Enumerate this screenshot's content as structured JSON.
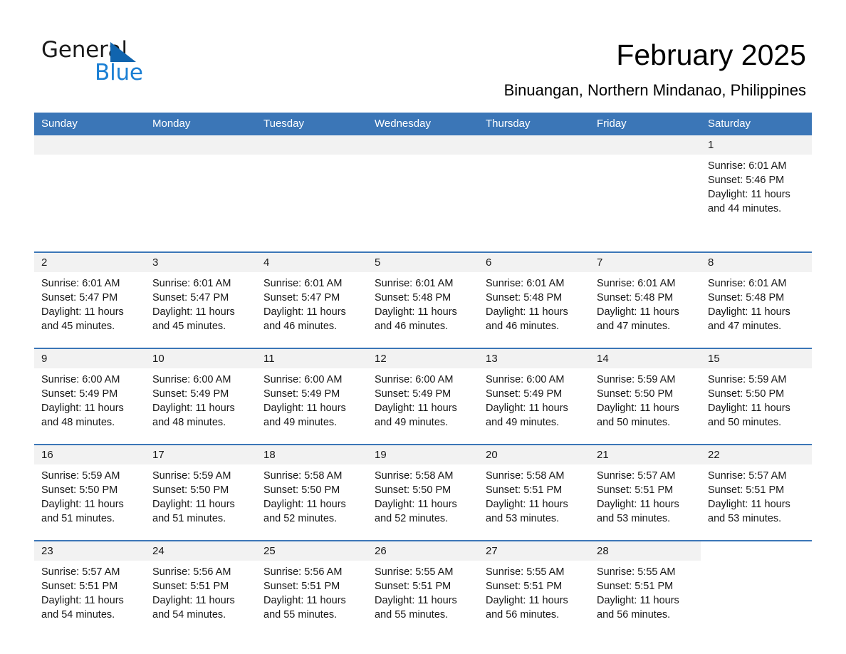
{
  "brand": {
    "name_part1": "General",
    "name_part2": "Blue",
    "triangle_color": "#1064ae",
    "blue_color": "#1a7fd4"
  },
  "header": {
    "title": "February 2025",
    "subtitle": "Binuangan, Northern Mindanao, Philippines"
  },
  "theme": {
    "header_blue": "#3b76b7",
    "daynum_band": "#f2f2f2",
    "text": "#161616"
  },
  "weekday_headers": [
    "Sunday",
    "Monday",
    "Tuesday",
    "Wednesday",
    "Thursday",
    "Friday",
    "Saturday"
  ],
  "labels": {
    "sunrise_prefix": "Sunrise: ",
    "sunset_prefix": "Sunset: ",
    "daylight_prefix": "Daylight: "
  },
  "weeks": [
    [
      {
        "day": "",
        "empty": true
      },
      {
        "day": "",
        "empty": true
      },
      {
        "day": "",
        "empty": true
      },
      {
        "day": "",
        "empty": true
      },
      {
        "day": "",
        "empty": true
      },
      {
        "day": "",
        "empty": true
      },
      {
        "day": "1",
        "sunrise": "Sunrise: 6:01 AM",
        "sunset": "Sunset: 5:46 PM",
        "daylight": "Daylight: 11 hours and 44 minutes."
      }
    ],
    [
      {
        "day": "2",
        "sunrise": "Sunrise: 6:01 AM",
        "sunset": "Sunset: 5:47 PM",
        "daylight": "Daylight: 11 hours and 45 minutes."
      },
      {
        "day": "3",
        "sunrise": "Sunrise: 6:01 AM",
        "sunset": "Sunset: 5:47 PM",
        "daylight": "Daylight: 11 hours and 45 minutes."
      },
      {
        "day": "4",
        "sunrise": "Sunrise: 6:01 AM",
        "sunset": "Sunset: 5:47 PM",
        "daylight": "Daylight: 11 hours and 46 minutes."
      },
      {
        "day": "5",
        "sunrise": "Sunrise: 6:01 AM",
        "sunset": "Sunset: 5:48 PM",
        "daylight": "Daylight: 11 hours and 46 minutes."
      },
      {
        "day": "6",
        "sunrise": "Sunrise: 6:01 AM",
        "sunset": "Sunset: 5:48 PM",
        "daylight": "Daylight: 11 hours and 46 minutes."
      },
      {
        "day": "7",
        "sunrise": "Sunrise: 6:01 AM",
        "sunset": "Sunset: 5:48 PM",
        "daylight": "Daylight: 11 hours and 47 minutes."
      },
      {
        "day": "8",
        "sunrise": "Sunrise: 6:01 AM",
        "sunset": "Sunset: 5:48 PM",
        "daylight": "Daylight: 11 hours and 47 minutes."
      }
    ],
    [
      {
        "day": "9",
        "sunrise": "Sunrise: 6:00 AM",
        "sunset": "Sunset: 5:49 PM",
        "daylight": "Daylight: 11 hours and 48 minutes."
      },
      {
        "day": "10",
        "sunrise": "Sunrise: 6:00 AM",
        "sunset": "Sunset: 5:49 PM",
        "daylight": "Daylight: 11 hours and 48 minutes."
      },
      {
        "day": "11",
        "sunrise": "Sunrise: 6:00 AM",
        "sunset": "Sunset: 5:49 PM",
        "daylight": "Daylight: 11 hours and 49 minutes."
      },
      {
        "day": "12",
        "sunrise": "Sunrise: 6:00 AM",
        "sunset": "Sunset: 5:49 PM",
        "daylight": "Daylight: 11 hours and 49 minutes."
      },
      {
        "day": "13",
        "sunrise": "Sunrise: 6:00 AM",
        "sunset": "Sunset: 5:49 PM",
        "daylight": "Daylight: 11 hours and 49 minutes."
      },
      {
        "day": "14",
        "sunrise": "Sunrise: 5:59 AM",
        "sunset": "Sunset: 5:50 PM",
        "daylight": "Daylight: 11 hours and 50 minutes."
      },
      {
        "day": "15",
        "sunrise": "Sunrise: 5:59 AM",
        "sunset": "Sunset: 5:50 PM",
        "daylight": "Daylight: 11 hours and 50 minutes."
      }
    ],
    [
      {
        "day": "16",
        "sunrise": "Sunrise: 5:59 AM",
        "sunset": "Sunset: 5:50 PM",
        "daylight": "Daylight: 11 hours and 51 minutes."
      },
      {
        "day": "17",
        "sunrise": "Sunrise: 5:59 AM",
        "sunset": "Sunset: 5:50 PM",
        "daylight": "Daylight: 11 hours and 51 minutes."
      },
      {
        "day": "18",
        "sunrise": "Sunrise: 5:58 AM",
        "sunset": "Sunset: 5:50 PM",
        "daylight": "Daylight: 11 hours and 52 minutes."
      },
      {
        "day": "19",
        "sunrise": "Sunrise: 5:58 AM",
        "sunset": "Sunset: 5:50 PM",
        "daylight": "Daylight: 11 hours and 52 minutes."
      },
      {
        "day": "20",
        "sunrise": "Sunrise: 5:58 AM",
        "sunset": "Sunset: 5:51 PM",
        "daylight": "Daylight: 11 hours and 53 minutes."
      },
      {
        "day": "21",
        "sunrise": "Sunrise: 5:57 AM",
        "sunset": "Sunset: 5:51 PM",
        "daylight": "Daylight: 11 hours and 53 minutes."
      },
      {
        "day": "22",
        "sunrise": "Sunrise: 5:57 AM",
        "sunset": "Sunset: 5:51 PM",
        "daylight": "Daylight: 11 hours and 53 minutes."
      }
    ],
    [
      {
        "day": "23",
        "sunrise": "Sunrise: 5:57 AM",
        "sunset": "Sunset: 5:51 PM",
        "daylight": "Daylight: 11 hours and 54 minutes."
      },
      {
        "day": "24",
        "sunrise": "Sunrise: 5:56 AM",
        "sunset": "Sunset: 5:51 PM",
        "daylight": "Daylight: 11 hours and 54 minutes."
      },
      {
        "day": "25",
        "sunrise": "Sunrise: 5:56 AM",
        "sunset": "Sunset: 5:51 PM",
        "daylight": "Daylight: 11 hours and 55 minutes."
      },
      {
        "day": "26",
        "sunrise": "Sunrise: 5:55 AM",
        "sunset": "Sunset: 5:51 PM",
        "daylight": "Daylight: 11 hours and 55 minutes."
      },
      {
        "day": "27",
        "sunrise": "Sunrise: 5:55 AM",
        "sunset": "Sunset: 5:51 PM",
        "daylight": "Daylight: 11 hours and 56 minutes."
      },
      {
        "day": "28",
        "sunrise": "Sunrise: 5:55 AM",
        "sunset": "Sunset: 5:51 PM",
        "daylight": "Daylight: 11 hours and 56 minutes."
      },
      {
        "day": "",
        "blank": true
      }
    ]
  ]
}
